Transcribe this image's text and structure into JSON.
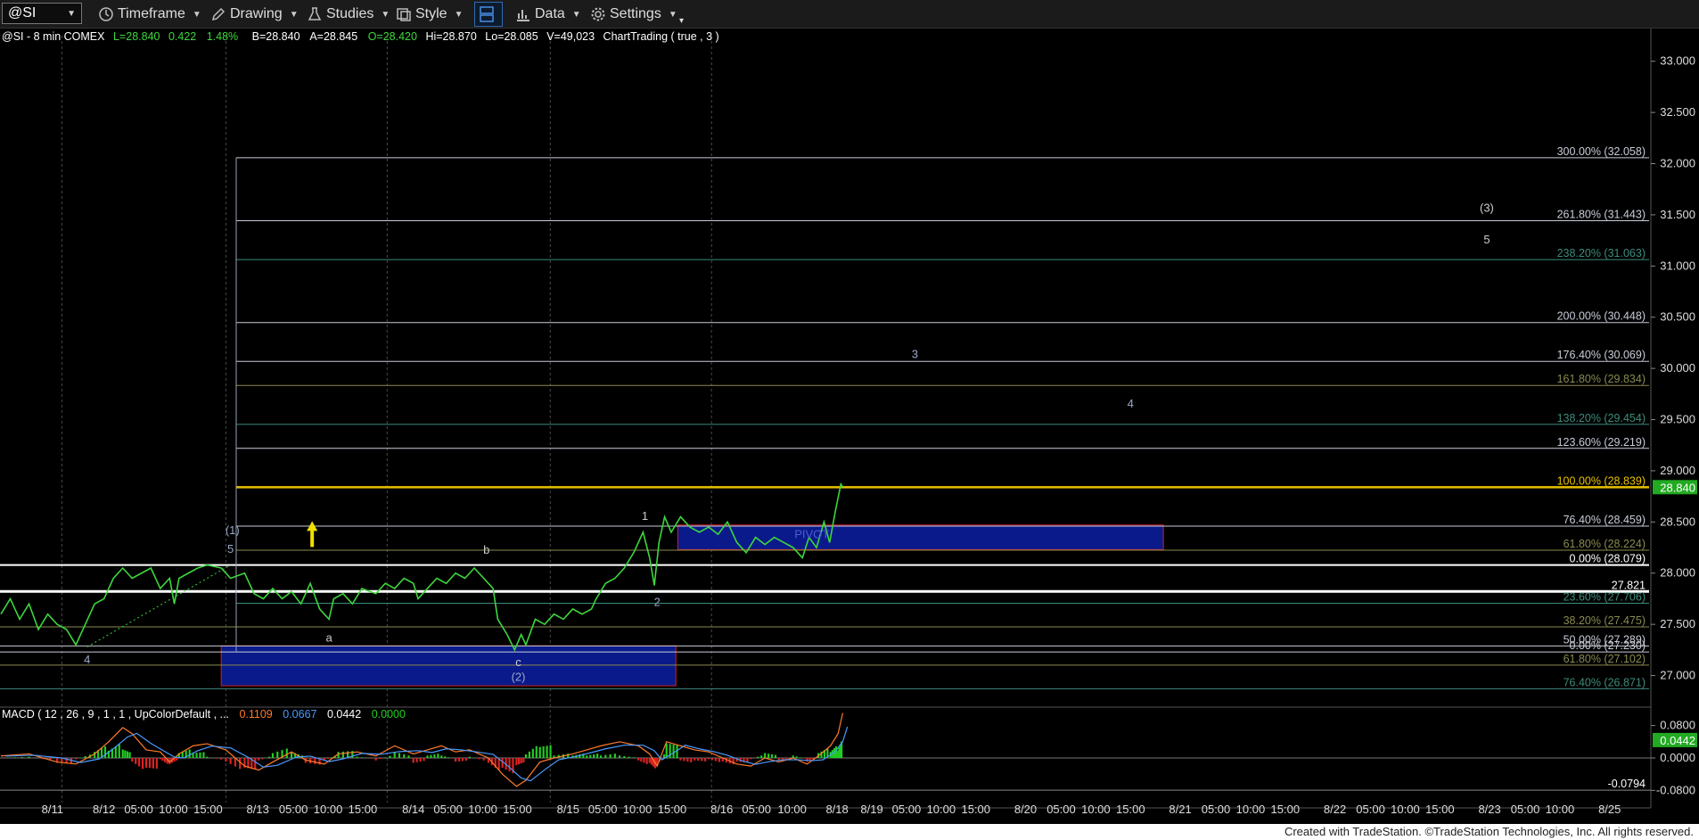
{
  "toolbar": {
    "symbol": "@SI",
    "timeframe_label": "Timeframe",
    "drawing_label": "Drawing",
    "studies_label": "Studies",
    "style_label": "Style",
    "data_label": "Data",
    "settings_label": "Settings"
  },
  "header": {
    "name": "@SI - 8 min  COMEX",
    "last": "L=28.840",
    "change": "0.422",
    "pct": "1.48%",
    "bid": "B=28.840",
    "ask": "A=28.845",
    "open": "O=28.420",
    "high": "Hi=28.870",
    "low": "Lo=28.085",
    "volume": "V=49,023",
    "chart_trading": "ChartTrading ( true , 3 )"
  },
  "macd_header": {
    "label": "MACD ( 12 , 26 , 9 , 1 , 1 , UpColorDefault , ...",
    "v1": "0.1109",
    "v2": "0.0667",
    "v3": "0.0442",
    "v4": "0.0000"
  },
  "footer_text": "Created with TradeStation. ©TradeStation Technologies, Inc. All rights reserved.",
  "colors": {
    "background": "#000000",
    "price": "#3dd63d",
    "fib_yellow": "#e8c000",
    "zone": "#0a1a8a",
    "zone_border": "#cc2222",
    "last_badge": "#22aa22",
    "macd_up": "#22cc22",
    "macd_down": "#dd2222"
  },
  "chart_data": {
    "type": "line",
    "price_axis": {
      "range": [
        26.7,
        33.25
      ],
      "ticks": [
        {
          "v": 33.0,
          "label": "33.000"
        },
        {
          "v": 32.5,
          "label": "32.500"
        },
        {
          "v": 32.0,
          "label": "32.000"
        },
        {
          "v": 31.5,
          "label": "31.500"
        },
        {
          "v": 31.0,
          "label": "31.000"
        },
        {
          "v": 30.5,
          "label": "30.500"
        },
        {
          "v": 30.0,
          "label": "30.000"
        },
        {
          "v": 29.5,
          "label": "29.500"
        },
        {
          "v": 29.0,
          "label": "29.000"
        },
        {
          "v": 28.5,
          "label": "28.500"
        },
        {
          "v": 28.0,
          "label": "28.000"
        },
        {
          "v": 27.5,
          "label": "27.500"
        },
        {
          "v": 27.0,
          "label": "27.000"
        }
      ],
      "last_price": {
        "v": 28.84,
        "label": "28.840"
      }
    },
    "macd_axis": {
      "range": [
        -0.11,
        0.11
      ],
      "ticks": [
        {
          "v": 0.08,
          "label": "0.0800"
        },
        {
          "v": 0.0,
          "label": "0.0000"
        },
        {
          "v": -0.08,
          "label": "-0.0800"
        }
      ],
      "badge": {
        "v": 0.0442,
        "label": "0.0442"
      },
      "min_marker": {
        "v": -0.0794,
        "label": "-0.0794"
      }
    },
    "x_labels": [
      {
        "t": 0.55,
        "label": "8/11"
      },
      {
        "t": 1.1,
        "label": "8/12"
      },
      {
        "t": 1.47,
        "label": "05:00"
      },
      {
        "t": 1.84,
        "label": "10:00"
      },
      {
        "t": 2.21,
        "label": "15:00"
      },
      {
        "t": 2.74,
        "label": "8/13"
      },
      {
        "t": 3.12,
        "label": "05:00"
      },
      {
        "t": 3.49,
        "label": "10:00"
      },
      {
        "t": 3.86,
        "label": "15:00"
      },
      {
        "t": 4.4,
        "label": "8/14"
      },
      {
        "t": 4.77,
        "label": "05:00"
      },
      {
        "t": 5.14,
        "label": "10:00"
      },
      {
        "t": 5.51,
        "label": "15:00"
      },
      {
        "t": 6.05,
        "label": "8/15"
      },
      {
        "t": 6.42,
        "label": "05:00"
      },
      {
        "t": 6.79,
        "label": "10:00"
      },
      {
        "t": 7.16,
        "label": "15:00"
      },
      {
        "t": 7.69,
        "label": "8/16"
      },
      {
        "t": 8.06,
        "label": "05:00"
      },
      {
        "t": 8.44,
        "label": "10:00"
      },
      {
        "t": 8.92,
        "label": "8/18"
      },
      {
        "t": 9.29,
        "label": "8/19"
      },
      {
        "t": 9.66,
        "label": "05:00"
      },
      {
        "t": 10.03,
        "label": "10:00"
      },
      {
        "t": 10.4,
        "label": "15:00"
      },
      {
        "t": 10.93,
        "label": "8/20"
      },
      {
        "t": 11.31,
        "label": "05:00"
      },
      {
        "t": 11.68,
        "label": "10:00"
      },
      {
        "t": 12.05,
        "label": "15:00"
      },
      {
        "t": 12.58,
        "label": "8/21"
      },
      {
        "t": 12.96,
        "label": "05:00"
      },
      {
        "t": 13.33,
        "label": "10:00"
      },
      {
        "t": 13.7,
        "label": "15:00"
      },
      {
        "t": 14.23,
        "label": "8/22"
      },
      {
        "t": 14.61,
        "label": "05:00"
      },
      {
        "t": 14.98,
        "label": "10:00"
      },
      {
        "t": 15.35,
        "label": "15:00"
      },
      {
        "t": 15.88,
        "label": "8/23"
      },
      {
        "t": 16.26,
        "label": "05:00"
      },
      {
        "t": 16.63,
        "label": "10:00"
      },
      {
        "t": 17.16,
        "label": "8/25"
      }
    ],
    "price_series": [
      [
        0.0,
        27.6
      ],
      [
        0.1,
        27.75
      ],
      [
        0.2,
        27.55
      ],
      [
        0.3,
        27.7
      ],
      [
        0.4,
        27.45
      ],
      [
        0.5,
        27.6
      ],
      [
        0.6,
        27.5
      ],
      [
        0.7,
        27.45
      ],
      [
        0.8,
        27.3
      ],
      [
        0.9,
        27.5
      ],
      [
        1.0,
        27.7
      ],
      [
        1.1,
        27.75
      ],
      [
        1.2,
        27.95
      ],
      [
        1.3,
        28.05
      ],
      [
        1.4,
        27.95
      ],
      [
        1.5,
        28.0
      ],
      [
        1.6,
        28.05
      ],
      [
        1.7,
        27.85
      ],
      [
        1.8,
        27.95
      ],
      [
        1.85,
        27.7
      ],
      [
        1.9,
        27.95
      ],
      [
        2.0,
        28.0
      ],
      [
        2.1,
        28.05
      ],
      [
        2.2,
        28.08
      ],
      [
        2.35,
        28.05
      ],
      [
        2.45,
        27.95
      ],
      [
        2.6,
        28.0
      ],
      [
        2.7,
        27.8
      ],
      [
        2.8,
        27.75
      ],
      [
        2.9,
        27.85
      ],
      [
        3.0,
        27.75
      ],
      [
        3.1,
        27.82
      ],
      [
        3.2,
        27.7
      ],
      [
        3.3,
        27.9
      ],
      [
        3.4,
        27.65
      ],
      [
        3.5,
        27.55
      ],
      [
        3.55,
        27.75
      ],
      [
        3.65,
        27.8
      ],
      [
        3.75,
        27.7
      ],
      [
        3.85,
        27.85
      ],
      [
        4.0,
        27.8
      ],
      [
        4.1,
        27.9
      ],
      [
        4.2,
        27.85
      ],
      [
        4.3,
        27.95
      ],
      [
        4.4,
        27.9
      ],
      [
        4.45,
        27.75
      ],
      [
        4.55,
        27.85
      ],
      [
        4.65,
        27.95
      ],
      [
        4.75,
        27.9
      ],
      [
        4.85,
        28.0
      ],
      [
        4.95,
        27.95
      ],
      [
        5.05,
        28.05
      ],
      [
        5.15,
        27.95
      ],
      [
        5.25,
        27.85
      ],
      [
        5.3,
        27.55
      ],
      [
        5.4,
        27.4
      ],
      [
        5.48,
        27.25
      ],
      [
        5.55,
        27.4
      ],
      [
        5.6,
        27.3
      ],
      [
        5.7,
        27.55
      ],
      [
        5.8,
        27.5
      ],
      [
        5.9,
        27.6
      ],
      [
        6.0,
        27.55
      ],
      [
        6.1,
        27.65
      ],
      [
        6.2,
        27.6
      ],
      [
        6.3,
        27.65
      ],
      [
        6.35,
        27.75
      ],
      [
        6.45,
        27.9
      ],
      [
        6.55,
        27.95
      ],
      [
        6.65,
        28.05
      ],
      [
        6.75,
        28.2
      ],
      [
        6.85,
        28.4
      ],
      [
        6.92,
        28.15
      ],
      [
        6.97,
        27.88
      ],
      [
        7.02,
        28.3
      ],
      [
        7.08,
        28.55
      ],
      [
        7.15,
        28.4
      ],
      [
        7.25,
        28.55
      ],
      [
        7.35,
        28.45
      ],
      [
        7.45,
        28.4
      ],
      [
        7.55,
        28.45
      ],
      [
        7.65,
        28.38
      ],
      [
        7.75,
        28.5
      ],
      [
        7.85,
        28.3
      ],
      [
        7.95,
        28.2
      ],
      [
        8.05,
        28.35
      ],
      [
        8.15,
        28.28
      ],
      [
        8.25,
        28.35
      ],
      [
        8.35,
        28.3
      ],
      [
        8.45,
        28.25
      ],
      [
        8.55,
        28.15
      ],
      [
        8.62,
        28.35
      ],
      [
        8.7,
        28.25
      ],
      [
        8.78,
        28.5
      ],
      [
        8.84,
        28.3
      ],
      [
        8.9,
        28.6
      ],
      [
        8.96,
        28.87
      ],
      [
        8.98,
        28.84
      ]
    ],
    "fib_levels": [
      {
        "v": 32.058,
        "label": "300.00% (32.058)",
        "color": "#c8ccd8"
      },
      {
        "v": 31.443,
        "label": "261.80% (31.443)",
        "color": "#c8ccd8"
      },
      {
        "v": 31.063,
        "label": "238.20% (31.063)",
        "color": "#3d8c7c"
      },
      {
        "v": 30.448,
        "label": "200.00% (30.448)",
        "color": "#c8ccd8"
      },
      {
        "v": 30.069,
        "label": "176.40% (30.069)",
        "color": "#c8ccd8"
      },
      {
        "v": 29.834,
        "label": "161.80% (29.834)",
        "color": "#8a8a50"
      },
      {
        "v": 29.454,
        "label": "138.20% (29.454)",
        "color": "#3d8c7c"
      },
      {
        "v": 29.219,
        "label": "123.60% (29.219)",
        "color": "#c8ccd8"
      },
      {
        "v": 28.839,
        "label": "100.00% (28.839)",
        "color": "#e8c000"
      },
      {
        "v": 28.459,
        "label": "76.40% (28.459)",
        "color": "#c8ccd8"
      },
      {
        "v": 28.224,
        "label": "61.80% (28.224)",
        "color": "#8a8a50"
      },
      {
        "v": 28.079,
        "label": "0.00% (28.079)",
        "color": "#ffffff"
      },
      {
        "v": 27.821,
        "label": "27.821",
        "color": "#ffffff"
      },
      {
        "v": 27.706,
        "label": "23.60% (27.706)",
        "color": "#3d8c7c"
      },
      {
        "v": 27.475,
        "label": "38.20% (27.475)",
        "color": "#8a8a50"
      },
      {
        "v": 27.289,
        "label": "50.00% (27.289)",
        "color": "#c8ccd8"
      },
      {
        "v": 27.23,
        "label": "0.00% (27.230)",
        "color": "#c8ccd8"
      },
      {
        "v": 27.102,
        "label": "61.80% (27.102)",
        "color": "#8a8a50"
      },
      {
        "v": 26.871,
        "label": "76.40% (26.871)",
        "color": "#3d8c7c"
      }
    ],
    "zones": [
      {
        "t0": 2.35,
        "t1": 7.2,
        "v0": 27.29,
        "v1": 26.9
      },
      {
        "t0": 7.22,
        "t1": 12.4,
        "v0": 28.47,
        "v1": 28.23
      }
    ],
    "wave_labels": [
      {
        "t": 2.47,
        "v": 28.38,
        "label": "(1)",
        "color": "#9aa8c8"
      },
      {
        "t": 2.45,
        "v": 28.2,
        "label": "5",
        "color": "#9aa8c8"
      },
      {
        "t": 0.92,
        "v": 27.12,
        "label": "4",
        "color": "#9aa8c8"
      },
      {
        "t": 3.5,
        "v": 27.33,
        "label": "a",
        "color": "#cccccc"
      },
      {
        "t": 5.18,
        "v": 28.19,
        "label": "b",
        "color": "#cccccc"
      },
      {
        "t": 5.52,
        "v": 27.09,
        "label": "c",
        "color": "#cccccc"
      },
      {
        "t": 5.52,
        "v": 26.95,
        "label": "(2)",
        "color": "#9aa8c8"
      },
      {
        "t": 6.87,
        "v": 28.52,
        "label": "1",
        "color": "#cccccc"
      },
      {
        "t": 7.0,
        "v": 27.68,
        "label": "2",
        "color": "#9aa8c8"
      },
      {
        "t": 8.65,
        "v": 28.34,
        "label": "PIVOT",
        "color": "#4b5cd8"
      },
      {
        "t": 9.75,
        "v": 30.1,
        "label": "3",
        "color": "#9aa8c8"
      },
      {
        "t": 12.05,
        "v": 29.62,
        "label": "4",
        "color": "#9aa8c8"
      },
      {
        "t": 15.85,
        "v": 31.53,
        "label": "(3)",
        "color": "#cccccc"
      },
      {
        "t": 15.85,
        "v": 31.22,
        "label": "5",
        "color": "#cccccc"
      }
    ],
    "macd_series": [
      [
        0.0,
        0.005
      ],
      [
        0.3,
        0.01
      ],
      [
        0.6,
        -0.01
      ],
      [
        0.8,
        -0.015
      ],
      [
        1.0,
        0.01
      ],
      [
        1.15,
        0.04
      ],
      [
        1.3,
        0.075
      ],
      [
        1.4,
        0.06
      ],
      [
        1.55,
        0.02
      ],
      [
        1.7,
        0.015
      ],
      [
        1.8,
        -0.01
      ],
      [
        1.9,
        0.01
      ],
      [
        2.05,
        0.03
      ],
      [
        2.2,
        0.035
      ],
      [
        2.4,
        0.02
      ],
      [
        2.6,
        -0.02
      ],
      [
        2.75,
        -0.03
      ],
      [
        2.9,
        -0.01
      ],
      [
        3.1,
        0.015
      ],
      [
        3.25,
        -0.005
      ],
      [
        3.45,
        -0.015
      ],
      [
        3.6,
        0.01
      ],
      [
        3.8,
        0.015
      ],
      [
        4.0,
        0.005
      ],
      [
        4.2,
        0.03
      ],
      [
        4.4,
        0.01
      ],
      [
        4.55,
        0.02
      ],
      [
        4.7,
        0.03
      ],
      [
        4.85,
        0.015
      ],
      [
        5.0,
        0.02
      ],
      [
        5.2,
        0.0
      ],
      [
        5.35,
        -0.04
      ],
      [
        5.5,
        -0.07
      ],
      [
        5.6,
        -0.055
      ],
      [
        5.75,
        -0.01
      ],
      [
        5.9,
        0.0
      ],
      [
        6.1,
        0.01
      ],
      [
        6.25,
        0.02
      ],
      [
        6.4,
        0.03
      ],
      [
        6.6,
        0.04
      ],
      [
        6.8,
        0.03
      ],
      [
        6.92,
        0.01
      ],
      [
        7.0,
        -0.02
      ],
      [
        7.1,
        0.04
      ],
      [
        7.25,
        0.03
      ],
      [
        7.4,
        0.02
      ],
      [
        7.55,
        0.015
      ],
      [
        7.7,
        0.0
      ],
      [
        7.85,
        -0.015
      ],
      [
        8.0,
        -0.02
      ],
      [
        8.15,
        0.0
      ],
      [
        8.3,
        -0.01
      ],
      [
        8.45,
        0.0
      ],
      [
        8.6,
        -0.015
      ],
      [
        8.72,
        0.005
      ],
      [
        8.85,
        0.03
      ],
      [
        8.93,
        0.06
      ],
      [
        8.98,
        0.1109
      ]
    ]
  }
}
